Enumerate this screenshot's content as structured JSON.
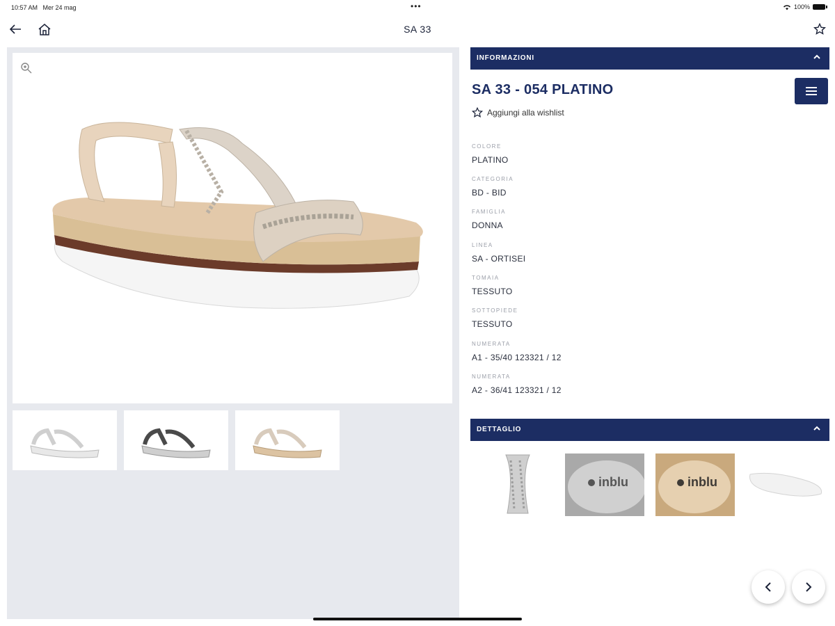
{
  "status_bar": {
    "time": "10:57 AM",
    "date": "Mer 24 mag",
    "battery": "100%"
  },
  "nav": {
    "title": "SA 33",
    "back_icon": "arrow-left-icon",
    "home_icon": "home-icon",
    "favorite_icon": "star-icon"
  },
  "info_section": {
    "header": "INFORMAZIONI",
    "product_title": "SA 33 - 054 PLATINO",
    "wishlist_label": "Aggiungi alla wishlist",
    "attributes": [
      {
        "label": "COLORE",
        "value": "PLATINO"
      },
      {
        "label": "CATEGORIA",
        "value": "BD - BID"
      },
      {
        "label": "FAMIGLIA",
        "value": "DONNA"
      },
      {
        "label": "LINEA",
        "value": "SA - ORTISEI"
      },
      {
        "label": "TOMAIA",
        "value": "TESSUTO"
      },
      {
        "label": "SOTTOPIEDE",
        "value": "TESSUTO"
      },
      {
        "label": "NUMERATA",
        "value": "A1 - 35/40 123321 / 12"
      },
      {
        "label": "NUMERATA",
        "value": "A2 - 36/41 123321 / 12"
      }
    ]
  },
  "detail_section": {
    "header": "DETTAGLIO",
    "brand_text": "inblu"
  },
  "colors": {
    "navy": "#1c2d63",
    "panel_bg": "#e7e9ee"
  }
}
